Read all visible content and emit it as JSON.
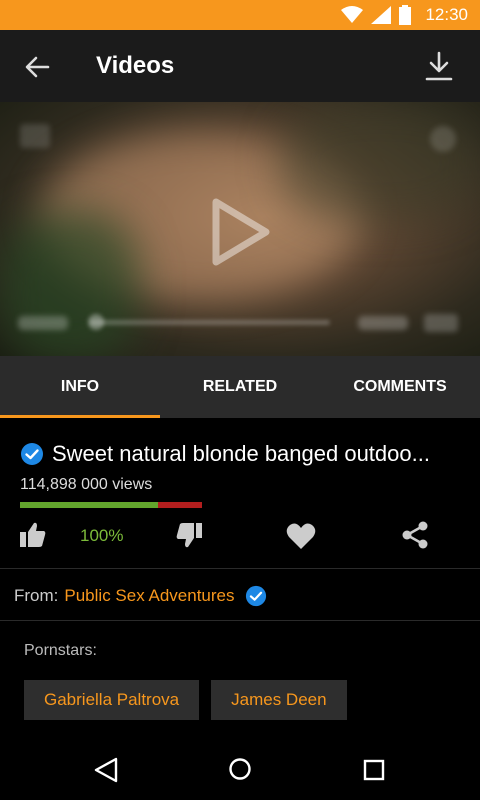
{
  "status_bar": {
    "time": "12:30",
    "icons": [
      "wifi-icon",
      "signal-icon",
      "battery-icon"
    ]
  },
  "app_bar": {
    "title": "Videos",
    "back_icon": "arrow-left-icon",
    "download_icon": "download-icon"
  },
  "tabs": [
    {
      "label": "INFO",
      "active": true
    },
    {
      "label": "RELATED",
      "active": false
    },
    {
      "label": "COMMENTS",
      "active": false
    }
  ],
  "video": {
    "title": "Sweet natural blonde banged outdoo...",
    "views": "114,898 000 views",
    "rating_percent": "100%",
    "rating_fraction": 0.76
  },
  "from": {
    "label": "From:",
    "channel": "Public Sex Adventures"
  },
  "pornstars": {
    "label": "Pornstars:",
    "items": [
      "Gabriella Paltrova",
      "James Deen"
    ]
  },
  "colors": {
    "accent": "#f7971d",
    "positive": "#7cbb3a",
    "negative": "#b21e1e",
    "verified": "#1e88e5"
  }
}
